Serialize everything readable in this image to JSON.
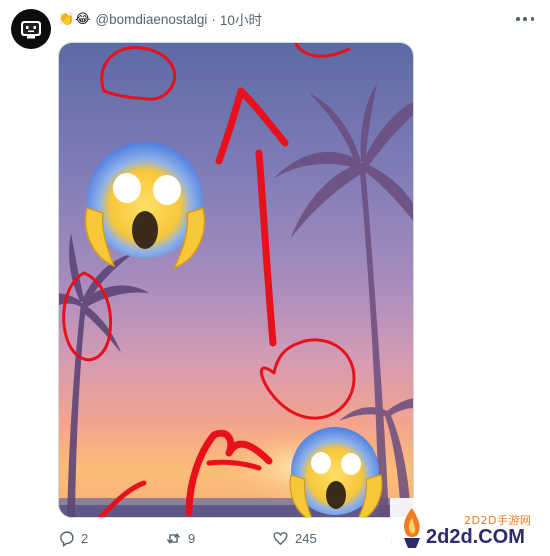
{
  "post": {
    "header_emojis": "👏😂",
    "handle": "@bomdiaenostalgi",
    "separator": "·",
    "time": "10小时",
    "avatar_icon": "tv-face-icon",
    "more_icon": "more-horizontal-icon"
  },
  "image": {
    "subject": "sunset-palm-beach-with-red-marker-circles-and-arrows",
    "emoji_overlay": "face-screaming-in-fear"
  },
  "actions": {
    "reply_count": "2",
    "retweet_count": "9",
    "like_count": "245"
  },
  "watermark": {
    "cn": "2D2D手游网",
    "en": "2d2d.COM"
  }
}
